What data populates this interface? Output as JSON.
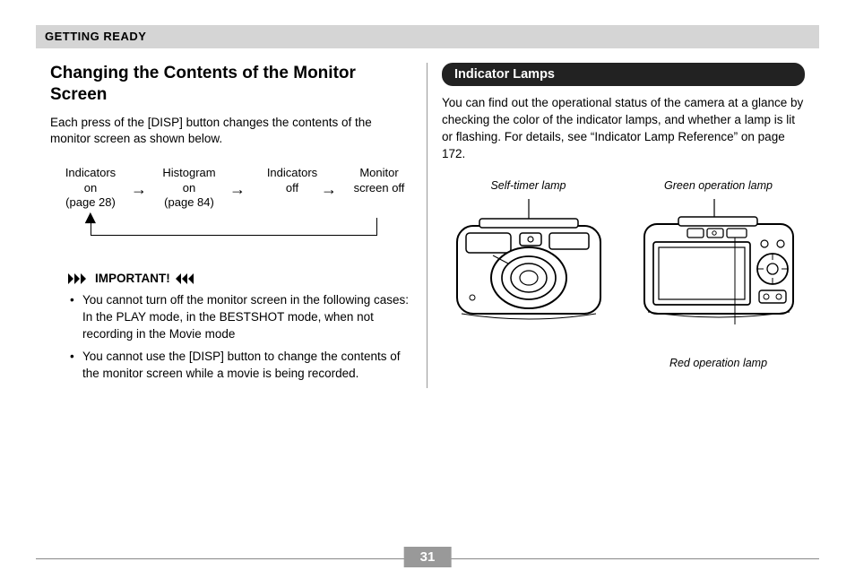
{
  "header": {
    "section": "GETTING READY"
  },
  "left": {
    "title": "Changing the Contents of the Monitor Screen",
    "intro": "Each press of the [DISP] button changes the contents of the monitor screen as shown below.",
    "flow": {
      "items": [
        "Indicators\non\n(page 28)",
        "Histogram\non\n(page 84)",
        "Indicators\noff",
        "Monitor\nscreen off"
      ]
    },
    "important_label": "IMPORTANT!",
    "bullets": [
      "You cannot turn off the monitor screen in the following cases:\nIn the PLAY mode, in the BESTSHOT mode, when not recording in the Movie mode",
      "You cannot use the [DISP] button to change the contents of the monitor screen while a movie is being recorded."
    ]
  },
  "right": {
    "heading": "Indicator Lamps",
    "intro": "You can find out the operational status of the camera at a glance by checking the color of the indicator lamps, and whether a lamp is lit or flashing. For details, see “Indicator Lamp Reference” on page 172.",
    "captions": {
      "self_timer": "Self-timer lamp",
      "green_op": "Green operation lamp",
      "red_op": "Red operation lamp"
    }
  },
  "page_number": "31"
}
